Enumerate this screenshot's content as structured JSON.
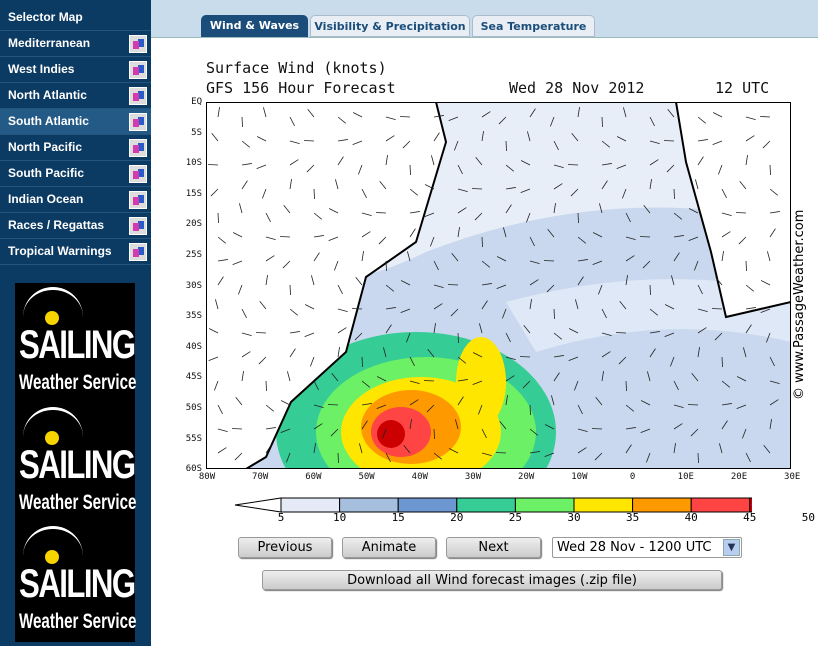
{
  "sidebar": {
    "items": [
      {
        "label": "Selector Map",
        "icon": false
      },
      {
        "label": "Mediterranean",
        "icon": true
      },
      {
        "label": "West Indies",
        "icon": true
      },
      {
        "label": "North Atlantic",
        "icon": true
      },
      {
        "label": "South Atlantic",
        "icon": true,
        "active": true
      },
      {
        "label": "North Pacific",
        "icon": true
      },
      {
        "label": "South Pacific",
        "icon": true
      },
      {
        "label": "Indian Ocean",
        "icon": true
      },
      {
        "label": "Races / Regattas",
        "icon": true
      },
      {
        "label": "Tropical Warnings",
        "icon": true
      }
    ],
    "logo": {
      "line1": "SAILING",
      "line2": "Weather Service"
    }
  },
  "tabs": [
    {
      "label": "Wind & Waves",
      "active": true
    },
    {
      "label": "Visibility & Precipitation"
    },
    {
      "label": "Sea Temperature"
    }
  ],
  "map": {
    "title1": "Surface Wind (knots)",
    "title2_left": "GFS 156 Hour Forecast",
    "title2_date": "Wed 28 Nov 2012",
    "title2_time": "12 UTC",
    "lat_labels": [
      "EQ",
      "5S",
      "10S",
      "15S",
      "20S",
      "25S",
      "30S",
      "35S",
      "40S",
      "45S",
      "50S",
      "55S",
      "60S"
    ],
    "lon_labels": [
      "80W",
      "70W",
      "60W",
      "50W",
      "40W",
      "30W",
      "20W",
      "10W",
      "0",
      "10E",
      "20E",
      "30E"
    ],
    "copyright": "© www.PassageWeather.com"
  },
  "colorbar": {
    "labels": [
      "5",
      "10",
      "15",
      "20",
      "25",
      "30",
      "35",
      "40",
      "45",
      "50"
    ],
    "colors": [
      "#e4eaf6",
      "#a7bfdf",
      "#6c97d0",
      "#35cc95",
      "#6cf065",
      "#ffe600",
      "#ff9900",
      "#ff4444",
      "#cc0000"
    ],
    "over_color": "#cc00cc"
  },
  "controls": {
    "previous": "Previous",
    "animate": "Animate",
    "next": "Next",
    "select_value": "Wed 28 Nov - 1200 UTC",
    "download": "Download all Wind forecast images (.zip file)"
  }
}
